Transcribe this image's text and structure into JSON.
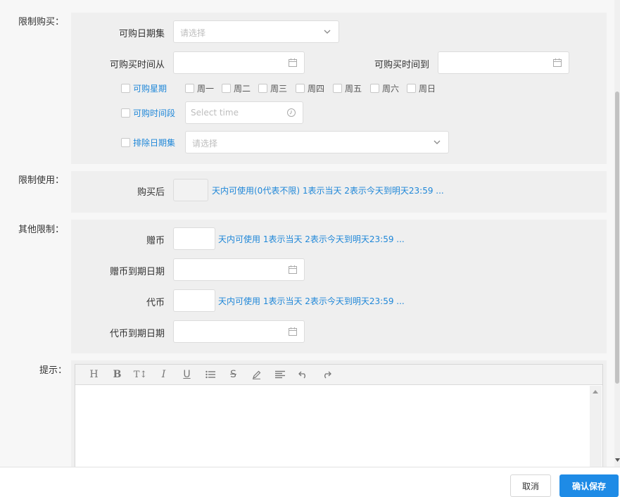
{
  "sections": {
    "purchase_limit_label": "限制购买：",
    "use_limit_label": "限制使用：",
    "other_limit_label": "其他限制：",
    "tips_label": "提示："
  },
  "purchase": {
    "date_set_label": "可购日期集",
    "date_set_placeholder": "请选择",
    "time_from_label": "可购买时间从",
    "time_to_label": "可购买时间到",
    "week_label": "可购星期",
    "weekdays": [
      "周一",
      "周二",
      "周三",
      "周四",
      "周五",
      "周六",
      "周日"
    ],
    "time_slot_label": "可购时间段",
    "time_slot_placeholder": "Select time",
    "exclude_label": "排除日期集",
    "exclude_placeholder": "请选择"
  },
  "use": {
    "after_purchase_label": "购买后",
    "after_purchase_hint": "天内可使用(0代表不限) 1表示当天 2表示今天到明天23:59 ..."
  },
  "other": {
    "gift_coin_label": "赠币",
    "gift_coin_hint": "天内可使用 1表示当天 2表示今天到明天23:59 ...",
    "gift_expire_label": "赠币到期日期",
    "token_label": "代币",
    "token_hint": "天内可使用 1表示当天 2表示今天到明天23:59 ...",
    "token_expire_label": "代币到期日期"
  },
  "editor": {
    "tools": [
      "H",
      "B",
      "TI",
      "I",
      "U",
      "list",
      "S",
      "pen",
      "align",
      "undo",
      "redo"
    ]
  },
  "footer": {
    "cancel": "取消",
    "save": "确认保存"
  },
  "colors": {
    "accent": "#1e8be6",
    "link": "#1f87d8",
    "panel": "#efefef"
  }
}
